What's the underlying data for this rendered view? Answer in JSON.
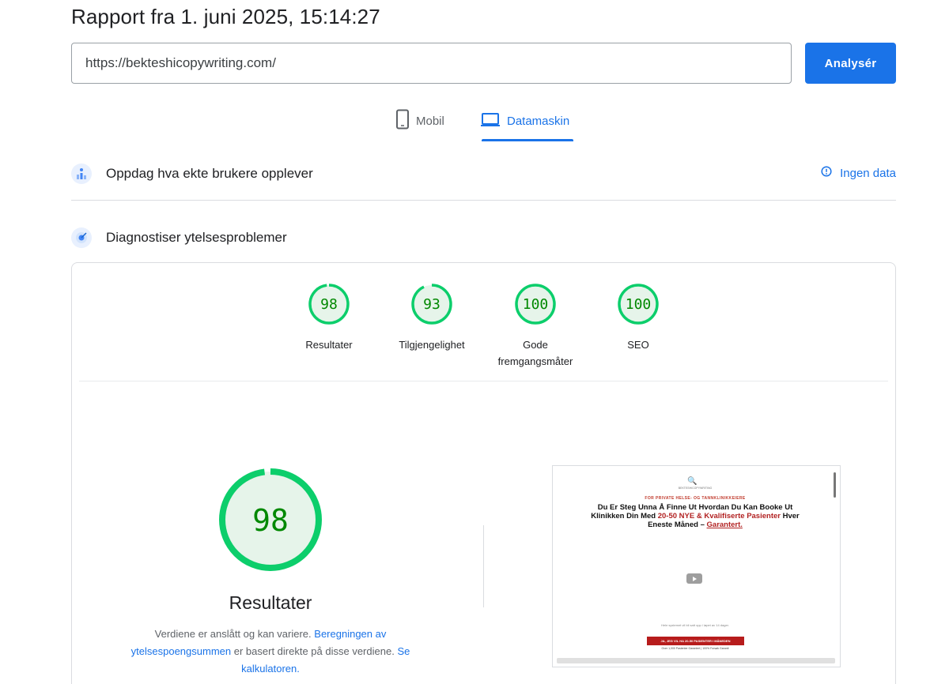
{
  "header": {
    "title": "Rapport fra 1. juni 2025, 15:14:27"
  },
  "search": {
    "url": "https://bekteshicopywriting.com/",
    "button_label": "Analysér"
  },
  "tabs": [
    {
      "label": "Mobil",
      "icon": "phone-icon",
      "active": false
    },
    {
      "label": "Datamaskin",
      "icon": "laptop-icon",
      "active": true
    }
  ],
  "field_data": {
    "title": "Oppdag hva ekte brukere opplever",
    "icon": "users-chart-icon",
    "status_label": "Ingen data",
    "status_icon": "info-icon"
  },
  "diagnostics": {
    "title": "Diagnostiser ytelsesproblemer",
    "icon": "lighthouse-icon"
  },
  "scores": [
    {
      "value": "98",
      "label": "Resultater",
      "fraction": 0.98
    },
    {
      "value": "93",
      "label": "Tilgjengelighet",
      "fraction": 0.93
    },
    {
      "value": "100",
      "label": "Gode fremgangsmåter",
      "fraction": 1.0
    },
    {
      "value": "100",
      "label": "SEO",
      "fraction": 1.0
    }
  ],
  "performance": {
    "score": "98",
    "label": "Resultater",
    "note_prefix": "Verdiene er anslått og kan variere.",
    "note_link1": "Beregningen av ytelsespoengsummen",
    "note_middle": "er basert direkte på disse verdiene.",
    "note_link2": "Se kalkulatoren."
  },
  "screenshot": {
    "logo": "🔍",
    "brand": "BEKTESHICOPYWRITING",
    "kicker": "FOR PRIVATE HELSE- OG TANNKLINIKKEIERE",
    "headline_part1": "Du Er Steg Unna Å Finne Ut Hvordan Du Kan Booke Ut Klinikken Din Med",
    "headline_red": "20-50 NYE & Kvalifiserte Pasienter",
    "headline_part2": "Hver Eneste Måned –",
    "headline_underline": "Garantert.",
    "small_text": "Hele systemet vil bli satt opp i løpet av 14 dager.",
    "cta": "JA, JEG VIL HA 20-50 PASIENTER I MÅNEDEN",
    "fine_print": "Over 1,000 Pasienter Garantert | 100% Forsøk Garanti"
  },
  "colors": {
    "accent": "#1a73e8",
    "pass_green": "#0cce6b",
    "pass_text": "#008800",
    "gauge_fill": "#e6f4ea"
  }
}
